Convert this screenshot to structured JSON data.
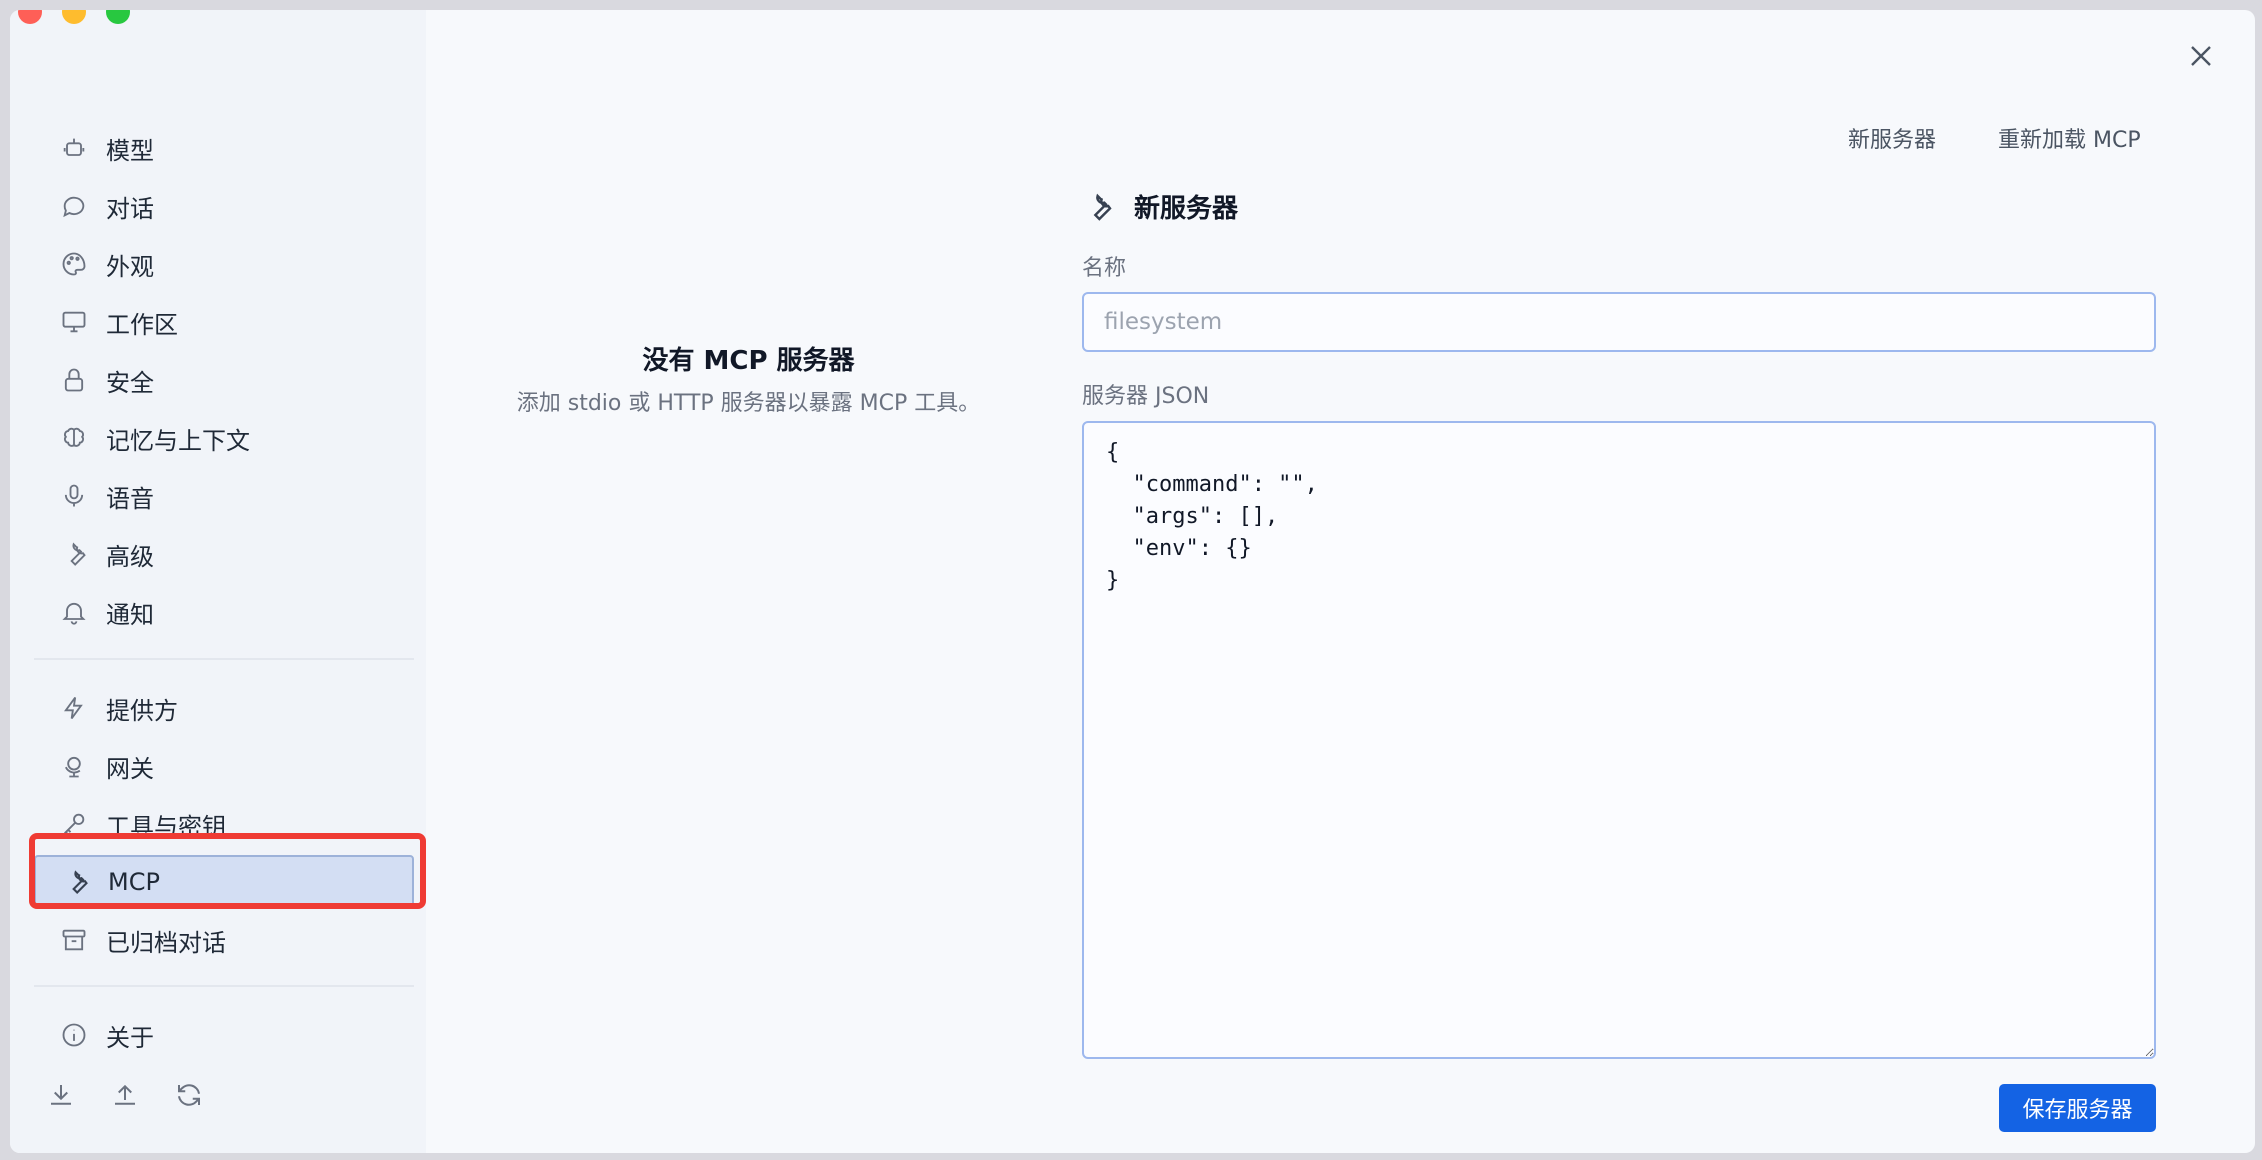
{
  "sidebar": {
    "items": [
      {
        "label": "模型",
        "icon": "bot-icon"
      },
      {
        "label": "对话",
        "icon": "chat-bubble-icon"
      },
      {
        "label": "外观",
        "icon": "palette-icon"
      },
      {
        "label": "工作区",
        "icon": "monitor-icon"
      },
      {
        "label": "安全",
        "icon": "lock-icon"
      },
      {
        "label": "记忆与上下文",
        "icon": "brain-icon"
      },
      {
        "label": "语音",
        "icon": "microphone-icon"
      },
      {
        "label": "高级",
        "icon": "wrench-icon"
      },
      {
        "label": "通知",
        "icon": "bell-icon"
      },
      {
        "label": "提供方",
        "icon": "lightning-icon"
      },
      {
        "label": "网关",
        "icon": "globe-stand-icon"
      },
      {
        "label": "工具与密钥",
        "icon": "key-icon"
      },
      {
        "label": "MCP",
        "icon": "wrench-icon"
      },
      {
        "label": "已归档对话",
        "icon": "archive-icon"
      },
      {
        "label": "关于",
        "icon": "info-icon"
      }
    ],
    "active": "MCP",
    "bottom_icons": [
      "download-icon",
      "upload-icon",
      "refresh-icon"
    ]
  },
  "header": {
    "new_server": "新服务器",
    "reload_mcp": "重新加载 MCP"
  },
  "empty_state": {
    "title": "没有 MCP 服务器",
    "description": "添加 stdio 或 HTTP 服务器以暴露 MCP 工具。"
  },
  "form": {
    "title": "新服务器",
    "name_label": "名称",
    "name_placeholder": "filesystem",
    "json_label": "服务器 JSON",
    "json_value": "{\n  \"command\": \"\",\n  \"args\": [],\n  \"env\": {}\n}",
    "save_label": "保存服务器"
  },
  "colors": {
    "accent": "#1463e4",
    "active_bg": "#d3def3",
    "highlight": "#ef3b34"
  }
}
